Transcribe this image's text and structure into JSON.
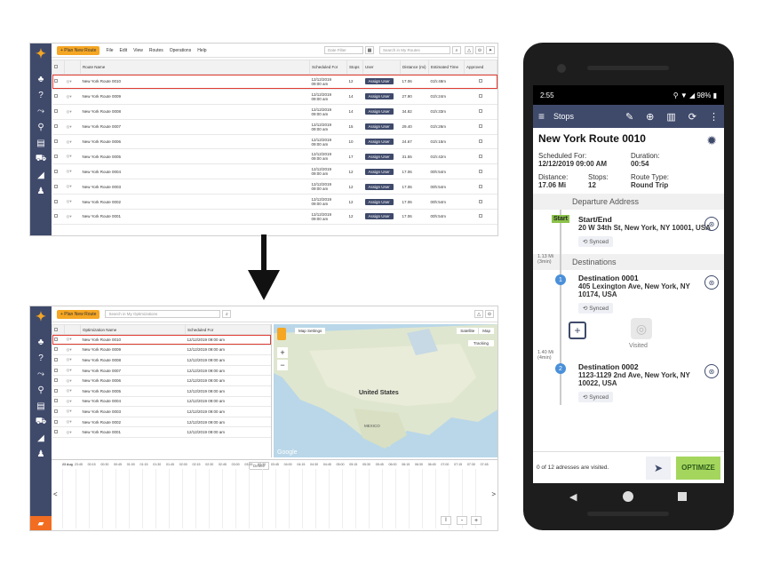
{
  "top_window": {
    "toolbar": {
      "plan_button": "+ Plan New Route",
      "menus": [
        "File",
        "Edit",
        "View",
        "Routes",
        "Operations",
        "Help"
      ],
      "date_filter": "Date Filter",
      "search_placeholder": "Search in My Routes"
    },
    "columns": [
      "Route Name",
      "Scheduled For",
      "Stops",
      "User",
      "Distance (mi)",
      "Estimated Time",
      "Approved"
    ],
    "assign_label": "Assign User",
    "rows": [
      {
        "name": "New York Route 0010",
        "date": "12/12/2019",
        "time": "09:00 am",
        "stops": "12",
        "dist": "17.06",
        "est": "01h:48m"
      },
      {
        "name": "New York Route 0009",
        "date": "12/12/2019",
        "time": "09:00 am",
        "stops": "14",
        "dist": "27.90",
        "est": "01h:24m"
      },
      {
        "name": "New York Route 0008",
        "date": "12/12/2019",
        "time": "09:00 am",
        "stops": "14",
        "dist": "34.82",
        "est": "01h:33m"
      },
      {
        "name": "New York Route 0007",
        "date": "12/12/2019",
        "time": "09:00 am",
        "stops": "15",
        "dist": "29.40",
        "est": "01h:26m"
      },
      {
        "name": "New York Route 0006",
        "date": "12/12/2019",
        "time": "09:00 am",
        "stops": "10",
        "dist": "24.67",
        "est": "01h:15m"
      },
      {
        "name": "New York Route 0005",
        "date": "12/12/2019",
        "time": "09:00 am",
        "stops": "17",
        "dist": "31.55",
        "est": "01h:42m"
      },
      {
        "name": "New York Route 0004",
        "date": "12/12/2019",
        "time": "09:00 am",
        "stops": "12",
        "dist": "17.06",
        "est": "00h:54m"
      },
      {
        "name": "New York Route 0003",
        "date": "12/12/2019",
        "time": "09:00 am",
        "stops": "12",
        "dist": "17.06",
        "est": "00h:54m"
      },
      {
        "name": "New York Route 0002",
        "date": "12/12/2019",
        "time": "09:00 am",
        "stops": "12",
        "dist": "17.06",
        "est": "00h:54m"
      },
      {
        "name": "New York Route 0001",
        "date": "12/12/2019",
        "time": "09:00 am",
        "stops": "12",
        "dist": "17.06",
        "est": "00h:54m"
      }
    ]
  },
  "bottom_window": {
    "plan_button": "+ Plan New Route",
    "search_placeholder": "Search in My Optimizations",
    "columns": [
      "Optimization Name",
      "Scheduled For"
    ],
    "rows": [
      {
        "name": "New York Route 0010",
        "sched": "12/12/2019 09:00 am"
      },
      {
        "name": "New York Route 0009",
        "sched": "12/12/2019 09:00 am"
      },
      {
        "name": "New York Route 0008",
        "sched": "12/12/2019 09:00 am"
      },
      {
        "name": "New York Route 0007",
        "sched": "12/12/2019 09:00 am"
      },
      {
        "name": "New York Route 0006",
        "sched": "12/12/2019 09:00 am"
      },
      {
        "name": "New York Route 0005",
        "sched": "12/12/2019 09:00 am"
      },
      {
        "name": "New York Route 0004",
        "sched": "12/12/2019 09:00 am"
      },
      {
        "name": "New York Route 0003",
        "sched": "12/12/2019 09:00 am"
      },
      {
        "name": "New York Route 0002",
        "sched": "12/12/2019 09:00 am"
      },
      {
        "name": "New York Route 0001",
        "sched": "12/12/2019 09:00 am"
      }
    ],
    "delete_label": "Delete",
    "map": {
      "settings": "Map Settings",
      "satellite": "Satellite",
      "map_label": "Map",
      "tracking": "Tracking",
      "country": "United States",
      "mexico": "MEXICO",
      "google": "Google"
    },
    "timeline": {
      "date": "23 Aug",
      "ticks": [
        "23:45",
        "00:15",
        "00:30",
        "00:45",
        "01:00",
        "01:15",
        "01:30",
        "01:45",
        "02:00",
        "02:15",
        "02:30",
        "02:45",
        "03:00",
        "03:15",
        "03:30",
        "03:45",
        "04:00",
        "04:15",
        "04:30",
        "04:45",
        "05:00",
        "05:15",
        "05:30",
        "05:45",
        "06:00",
        "06:15",
        "06:30",
        "06:45",
        "07:00",
        "07:15",
        "07:30",
        "07:45"
      ],
      "left": "<",
      "right": ">",
      "zoom_minus": "-",
      "zoom_plus": "+"
    }
  },
  "phone": {
    "time": "2:55",
    "battery": "98%",
    "app_title": "Stops",
    "route_title": "New York Route 0010",
    "scheduled_label": "Scheduled For:",
    "scheduled_value": "12/12/2019 09:00 AM",
    "duration_label": "Duration:",
    "duration_value": "00:54",
    "distance_label": "Distance:",
    "distance_value": "17.06 Mi",
    "stops_label": "Stops:",
    "stops_value": "12",
    "route_type_label": "Route Type:",
    "route_type_value": "Round Trip",
    "departure_header": "Departure Address",
    "start_badge": "Start",
    "start_title": "Start/End",
    "start_address": "20 W 34th St, New York, NY 10001, USA",
    "synced": "Synced",
    "leg1": "1.13 Mi (3min)",
    "destinations_header": "Destinations",
    "dest1_num": "1",
    "dest1_title": "Destination 0001",
    "dest1_address": "405 Lexington Ave, New York, NY 10174, USA",
    "leg2": "1.40 Mi (4min)",
    "visited": "Visited",
    "dest2_num": "2",
    "dest2_title": "Destination 0002",
    "dest2_address": "1123-1129 2nd Ave, New York, NY 10022, USA",
    "visited_count": "0 of 12 adresses are visited.",
    "optimize": "OPTIMIZE"
  }
}
